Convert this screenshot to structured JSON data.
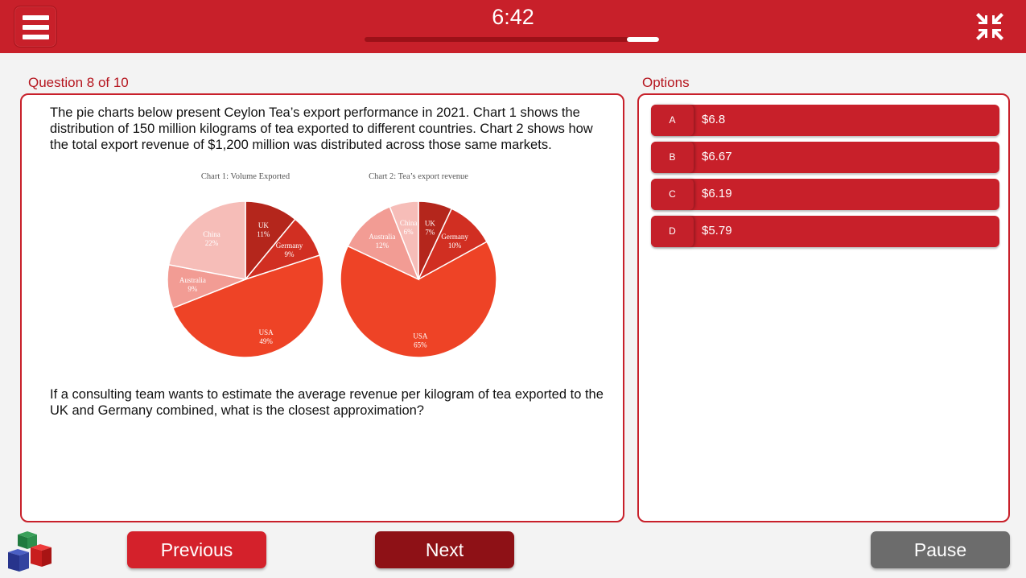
{
  "header": {
    "timer": "6:42",
    "progress": 0.11
  },
  "question": {
    "counter": "Question 8 of 10",
    "intro": "The pie charts below present Ceylon Tea’s export performance in 2021. Chart 1 shows the distribution of 150 million kilograms of tea exported to different countries. Chart 2 shows how the total export revenue of $1,200 million was distributed across those same markets.",
    "prompt": "If a consulting team wants to estimate the average revenue per kilogram of tea exported to the UK and Germany combined, what is the closest approximation?"
  },
  "options": {
    "label": "Options",
    "items": [
      {
        "letter": "A",
        "text": "$6.8"
      },
      {
        "letter": "B",
        "text": "$6.67"
      },
      {
        "letter": "C",
        "text": "$6.19"
      },
      {
        "letter": "D",
        "text": "$5.79"
      }
    ]
  },
  "nav": {
    "previous": "Previous",
    "next": "Next",
    "pause": "Pause"
  },
  "colors": {
    "accent": "#c8202a",
    "next_button": "#8e1116",
    "pause_button": "#6c6c6c"
  },
  "chart_data": [
    {
      "type": "pie",
      "title": "Chart 1: Volume Exported",
      "categories": [
        "UK",
        "Germany",
        "USA",
        "Australia",
        "China"
      ],
      "values": [
        11,
        9,
        49,
        9,
        22
      ],
      "labels": [
        "11%",
        "9%",
        "49%",
        "9%",
        "22%"
      ],
      "colors": [
        "#b4261c",
        "#d12f22",
        "#ee4326",
        "#f29c94",
        "#f6bdb8"
      ]
    },
    {
      "type": "pie",
      "title": "Chart 2: Tea’s export revenue",
      "categories": [
        "UK",
        "Germany",
        "USA",
        "Australia",
        "China"
      ],
      "values": [
        7,
        10,
        65,
        12,
        6
      ],
      "labels": [
        "7%",
        "10%",
        "65%",
        "12%",
        "6%"
      ],
      "colors": [
        "#b4261c",
        "#d12f22",
        "#ee4326",
        "#f29c94",
        "#f6bdb8"
      ]
    }
  ]
}
